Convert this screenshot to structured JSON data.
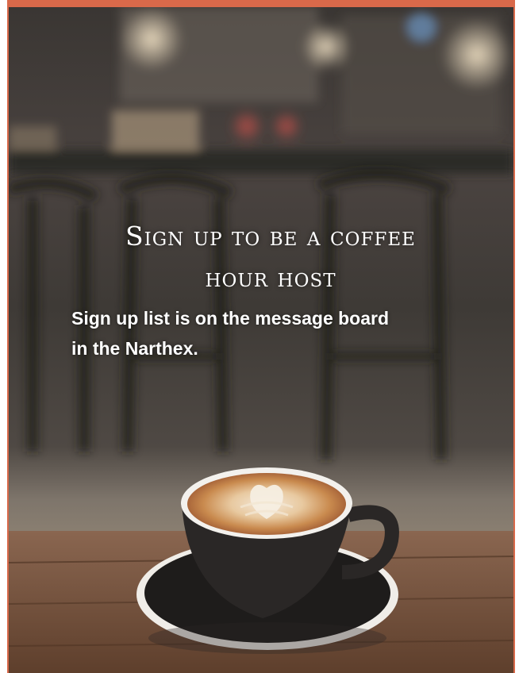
{
  "flyer": {
    "title_line1": "Sign up to be a coffee",
    "title_line2": "hour host",
    "subtitle": "Sign up list is on the message board in the Narthex.",
    "accent_color": "#d9694a"
  },
  "photo": {
    "subject": "latte-art-coffee-cup-icon"
  }
}
